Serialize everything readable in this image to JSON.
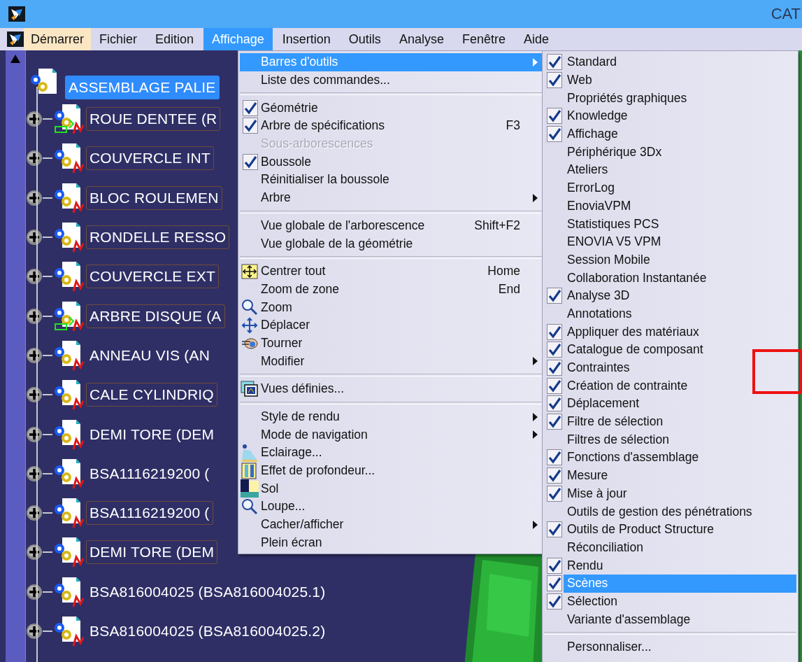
{
  "window": {
    "title": "CAT"
  },
  "menu_bar": [
    {
      "label": "Démarrer",
      "kind": "start",
      "selected": false
    },
    {
      "label": "Fichier",
      "kind": "menu",
      "selected": false
    },
    {
      "label": "Edition",
      "kind": "menu",
      "selected": false
    },
    {
      "label": "Affichage",
      "kind": "menu",
      "selected": true
    },
    {
      "label": "Insertion",
      "kind": "menu",
      "selected": false
    },
    {
      "label": "Outils",
      "kind": "menu",
      "selected": false
    },
    {
      "label": "Analyse",
      "kind": "menu",
      "selected": false
    },
    {
      "label": "Fenêtre",
      "kind": "menu",
      "selected": false
    },
    {
      "label": "Aide",
      "kind": "menu",
      "selected": false
    }
  ],
  "tree": {
    "root": {
      "label": "ASSEMBLAGE PALIE",
      "selected": true
    },
    "children": [
      {
        "label": "ROUE DENTEE (R",
        "framed": true,
        "kind": "linked"
      },
      {
        "label": "COUVERCLE INT",
        "framed": true,
        "kind": "part"
      },
      {
        "label": "BLOC ROULEMEN",
        "framed": true,
        "kind": "part"
      },
      {
        "label": "RONDELLE RESSO",
        "framed": true,
        "kind": "part"
      },
      {
        "label": "COUVERCLE EXT",
        "framed": true,
        "kind": "part"
      },
      {
        "label": "ARBRE DISQUE (A",
        "framed": true,
        "kind": "linked"
      },
      {
        "label": "ANNEAU VIS (AN",
        "framed": false,
        "kind": "part"
      },
      {
        "label": "CALE CYLINDRIQ",
        "framed": true,
        "kind": "part"
      },
      {
        "label": "DEMI TORE (DEM",
        "framed": false,
        "kind": "part"
      },
      {
        "label": "BSA1116219200 (",
        "framed": false,
        "kind": "part"
      },
      {
        "label": "BSA1116219200 (",
        "framed": true,
        "kind": "part"
      },
      {
        "label": "DEMI TORE (DEM",
        "framed": true,
        "kind": "part"
      },
      {
        "label": "BSA816004025 (BSA816004025.1)",
        "framed": false,
        "kind": "part"
      },
      {
        "label": "BSA816004025 (BSA816004025.2)",
        "framed": false,
        "kind": "part"
      }
    ]
  },
  "view_menu": [
    {
      "kind": "item",
      "label": "Barres d'outils",
      "submenu": true,
      "selected": true,
      "checked": false,
      "disabled": false
    },
    {
      "kind": "item",
      "label": "Liste des commandes...",
      "submenu": false,
      "selected": false,
      "checked": false,
      "disabled": false
    },
    {
      "kind": "separator"
    },
    {
      "kind": "item",
      "label": "Géométrie",
      "submenu": false,
      "selected": false,
      "checked": true,
      "disabled": false
    },
    {
      "kind": "item",
      "label": "Arbre de spécifications",
      "shortcut": "F3",
      "submenu": false,
      "selected": false,
      "checked": true,
      "disabled": false
    },
    {
      "kind": "item",
      "label": "Sous-arborescences",
      "submenu": false,
      "selected": false,
      "checked": false,
      "disabled": true
    },
    {
      "kind": "item",
      "label": "Boussole",
      "submenu": false,
      "selected": false,
      "checked": true,
      "disabled": false
    },
    {
      "kind": "item",
      "label": "Réinitialiser la boussole",
      "submenu": false,
      "selected": false,
      "checked": false,
      "disabled": false
    },
    {
      "kind": "item",
      "label": "Arbre",
      "submenu": true,
      "selected": false,
      "checked": false,
      "disabled": false
    },
    {
      "kind": "separator"
    },
    {
      "kind": "item",
      "label": "Vue globale de l'arborescence",
      "shortcut": "Shift+F2",
      "submenu": false,
      "selected": false,
      "checked": false,
      "disabled": false
    },
    {
      "kind": "item",
      "label": "Vue globale de la géométrie",
      "submenu": false,
      "selected": false,
      "checked": false,
      "disabled": false
    },
    {
      "kind": "separator"
    },
    {
      "kind": "item",
      "label": "Centrer tout",
      "shortcut": "Home",
      "submenu": false,
      "selected": false,
      "checked": false,
      "disabled": false
    },
    {
      "kind": "item",
      "label": "Zoom de zone",
      "shortcut": "End",
      "submenu": false,
      "selected": false,
      "checked": false,
      "disabled": false
    },
    {
      "kind": "item",
      "label": "Zoom",
      "submenu": false,
      "selected": false,
      "checked": false,
      "disabled": false
    },
    {
      "kind": "item",
      "label": "Déplacer",
      "submenu": false,
      "selected": false,
      "checked": false,
      "disabled": false
    },
    {
      "kind": "item",
      "label": "Tourner",
      "submenu": false,
      "selected": false,
      "checked": false,
      "disabled": false
    },
    {
      "kind": "item",
      "label": "Modifier",
      "submenu": true,
      "selected": false,
      "checked": false,
      "disabled": false
    },
    {
      "kind": "separator"
    },
    {
      "kind": "item",
      "label": "Vues définies...",
      "submenu": false,
      "selected": false,
      "checked": false,
      "disabled": false
    },
    {
      "kind": "separator"
    },
    {
      "kind": "item",
      "label": "Style de rendu",
      "submenu": true,
      "selected": false,
      "checked": false,
      "disabled": false
    },
    {
      "kind": "item",
      "label": "Mode de navigation",
      "submenu": true,
      "selected": false,
      "checked": false,
      "disabled": false
    },
    {
      "kind": "item",
      "label": "Eclairage...",
      "submenu": false,
      "selected": false,
      "checked": false,
      "disabled": false
    },
    {
      "kind": "item",
      "label": "Effet de profondeur...",
      "submenu": false,
      "selected": false,
      "checked": false,
      "disabled": false
    },
    {
      "kind": "item",
      "label": "Sol",
      "submenu": false,
      "selected": false,
      "checked": false,
      "disabled": false
    },
    {
      "kind": "item",
      "label": "Loupe...",
      "submenu": false,
      "selected": false,
      "checked": false,
      "disabled": false
    },
    {
      "kind": "item",
      "label": "Cacher/afficher",
      "submenu": true,
      "selected": false,
      "checked": false,
      "disabled": false
    },
    {
      "kind": "item",
      "label": "Plein écran",
      "submenu": false,
      "selected": false,
      "checked": false,
      "disabled": false
    }
  ],
  "toolbars_menu": [
    {
      "kind": "item",
      "label": "Standard",
      "checked": true,
      "selected": false
    },
    {
      "kind": "item",
      "label": "Web",
      "checked": true,
      "selected": false
    },
    {
      "kind": "item",
      "label": "Propriétés graphiques",
      "checked": false,
      "selected": false
    },
    {
      "kind": "item",
      "label": "Knowledge",
      "checked": true,
      "selected": false
    },
    {
      "kind": "item",
      "label": "Affichage",
      "checked": true,
      "selected": false
    },
    {
      "kind": "item",
      "label": "Périphérique 3Dx",
      "checked": false,
      "selected": false
    },
    {
      "kind": "item",
      "label": "Ateliers",
      "checked": false,
      "selected": false
    },
    {
      "kind": "item",
      "label": "ErrorLog",
      "checked": false,
      "selected": false
    },
    {
      "kind": "item",
      "label": "EnoviaVPM",
      "checked": false,
      "selected": false
    },
    {
      "kind": "item",
      "label": "Statistiques PCS",
      "checked": false,
      "selected": false
    },
    {
      "kind": "item",
      "label": "ENOVIA V5 VPM",
      "checked": false,
      "selected": false
    },
    {
      "kind": "item",
      "label": "Session Mobile",
      "checked": false,
      "selected": false
    },
    {
      "kind": "item",
      "label": "Collaboration Instantanée",
      "checked": false,
      "selected": false
    },
    {
      "kind": "item",
      "label": "Analyse 3D",
      "checked": true,
      "selected": false
    },
    {
      "kind": "item",
      "label": "Annotations",
      "checked": false,
      "selected": false
    },
    {
      "kind": "item",
      "label": "Appliquer des matériaux",
      "checked": true,
      "selected": false
    },
    {
      "kind": "item",
      "label": "Catalogue de composant",
      "checked": true,
      "selected": false
    },
    {
      "kind": "item",
      "label": "Contraintes",
      "checked": true,
      "selected": false
    },
    {
      "kind": "item",
      "label": "Création de contrainte",
      "checked": true,
      "selected": false
    },
    {
      "kind": "item",
      "label": "Déplacement",
      "checked": true,
      "selected": false
    },
    {
      "kind": "item",
      "label": "Filtre de sélection",
      "checked": true,
      "selected": false
    },
    {
      "kind": "item",
      "label": "Filtres de sélection",
      "checked": false,
      "selected": false
    },
    {
      "kind": "item",
      "label": "Fonctions d'assemblage",
      "checked": true,
      "selected": false
    },
    {
      "kind": "item",
      "label": "Mesure",
      "checked": true,
      "selected": false
    },
    {
      "kind": "item",
      "label": "Mise à jour",
      "checked": true,
      "selected": false
    },
    {
      "kind": "item",
      "label": "Outils de gestion des pénétrations",
      "checked": false,
      "selected": false
    },
    {
      "kind": "item",
      "label": "Outils de Product Structure",
      "checked": true,
      "selected": false
    },
    {
      "kind": "item",
      "label": "Réconciliation",
      "checked": false,
      "selected": false
    },
    {
      "kind": "item",
      "label": "Rendu",
      "checked": true,
      "selected": false
    },
    {
      "kind": "item",
      "label": "Scènes",
      "checked": true,
      "selected": true
    },
    {
      "kind": "item",
      "label": "Sélection",
      "checked": true,
      "selected": false
    },
    {
      "kind": "item",
      "label": "Variante d'assemblage",
      "checked": false,
      "selected": false
    },
    {
      "kind": "separator"
    },
    {
      "kind": "item",
      "label": "Personnaliser...",
      "checked": false,
      "selected": false
    }
  ]
}
